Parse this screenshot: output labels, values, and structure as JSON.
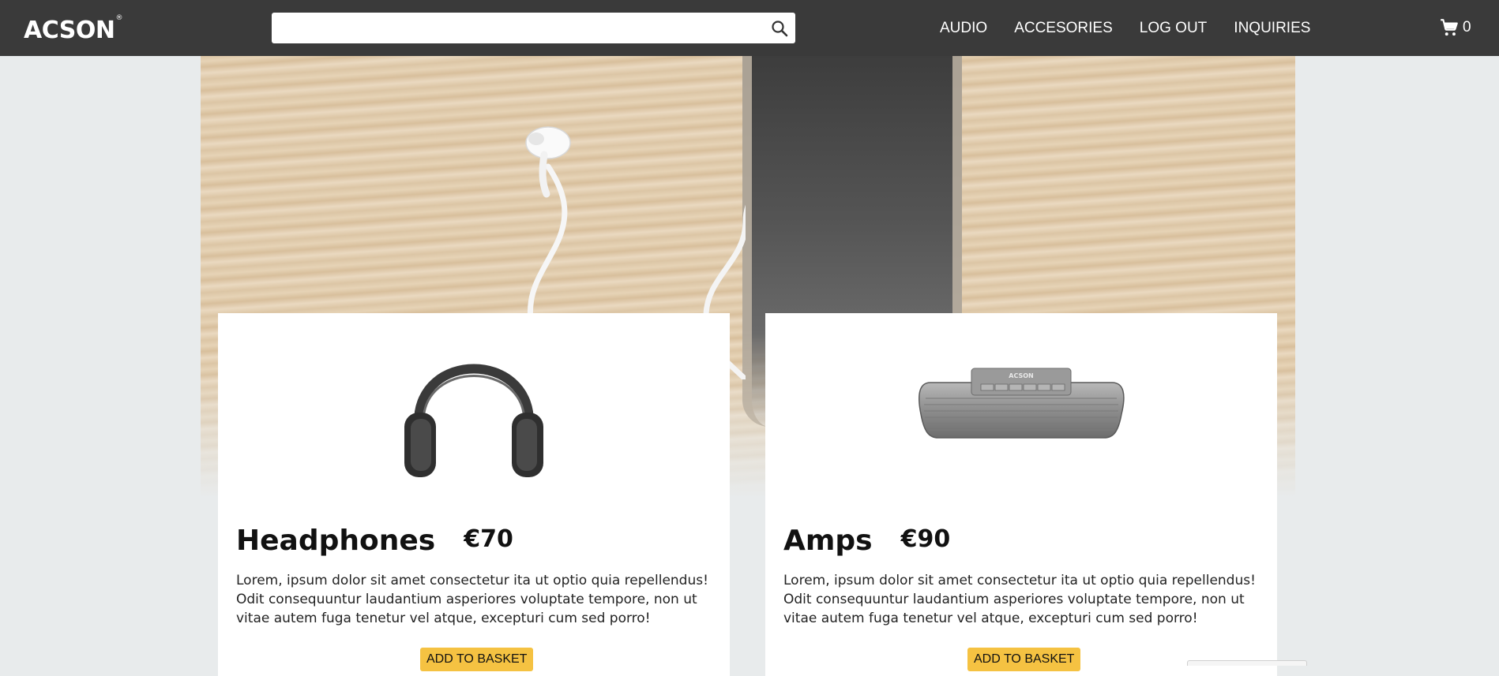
{
  "brand": {
    "logo_text": "ACSON",
    "logo_mark": "®"
  },
  "search": {
    "value": "",
    "placeholder": "",
    "icon": "search-icon"
  },
  "nav": {
    "links": [
      {
        "label": "AUDIO"
      },
      {
        "label": "ACCESORIES"
      },
      {
        "label": "LOG OUT"
      },
      {
        "label": "INQUIRIES"
      }
    ]
  },
  "cart": {
    "icon": "cart-icon",
    "count": "0"
  },
  "products": [
    {
      "name": "Headphones",
      "price": "€70",
      "description": "Lorem, ipsum dolor sit amet consectetur ita ut optio quia repellendus! Odit consequuntur laudantium asperiores voluptate tempore, non ut vitae autem fuga tenetur vel atque, excepturi cum sed porro!",
      "button_label": "ADD TO BASKET",
      "image": "headphones-image"
    },
    {
      "name": "Amps",
      "price": "€90",
      "description": "Lorem, ipsum dolor sit amet consectetur ita ut optio quia repellendus! Odit consequuntur laudantium asperiores voluptate tempore, non ut vitae autem fuga tenetur vel atque, excepturi cum sed porro!",
      "button_label": "ADD TO BASKET",
      "image": "speaker-image",
      "speaker_brand": "ACSON"
    }
  ],
  "colors": {
    "navbar": "#3a3a3a",
    "background": "#e8ebec",
    "button": "#f5c242"
  }
}
